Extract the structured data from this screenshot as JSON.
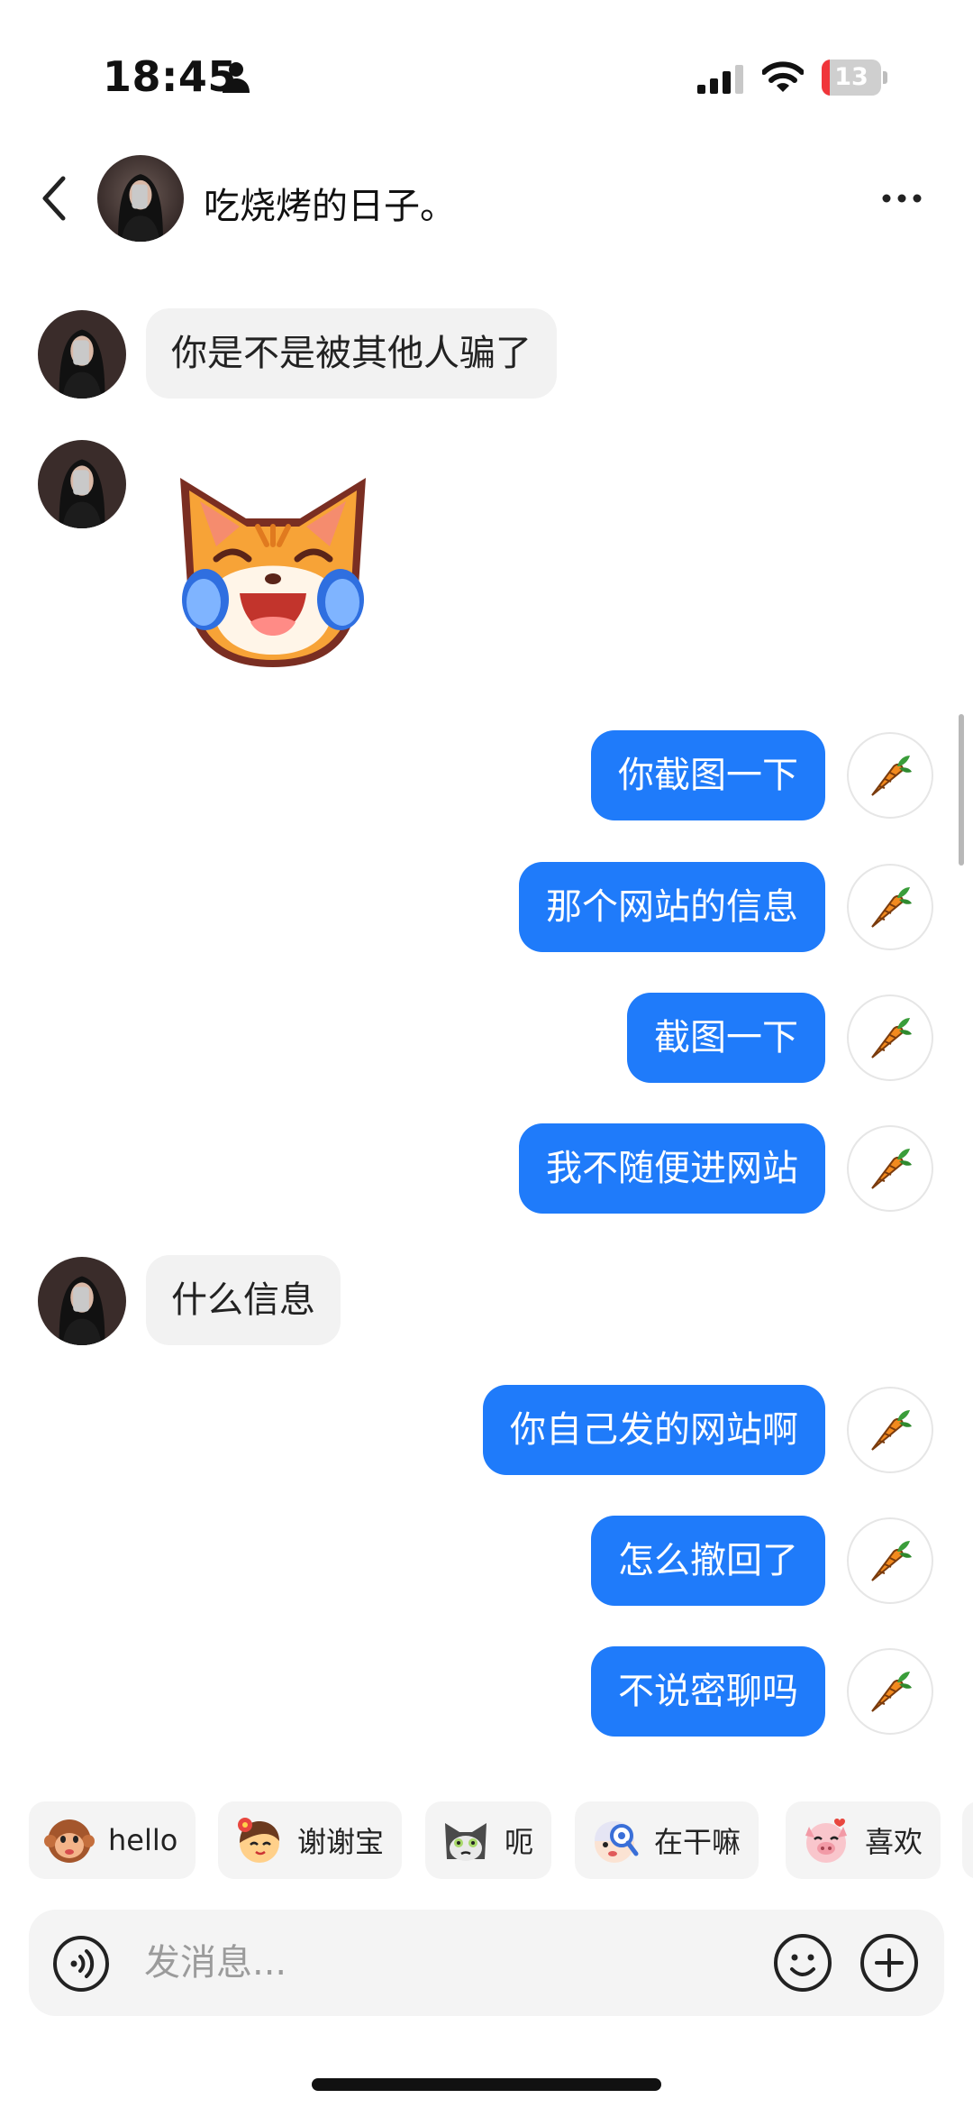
{
  "status_bar": {
    "time": "18:45",
    "battery": {
      "label": "13",
      "level_percent": 13,
      "color": "#f0353a"
    },
    "icons": [
      "person-icon",
      "signal-icon",
      "wifi-icon",
      "battery-icon"
    ]
  },
  "header": {
    "back_icon": "chevron-left-icon",
    "title": "吃烧烤的日子。",
    "more_icon": "more-dots-icon"
  },
  "colors": {
    "outgoing_bubble": "#1f7bfa",
    "incoming_bubble": "#f2f2f2"
  },
  "messages": [
    {
      "side": "incoming",
      "type": "text",
      "text": "你是不是被其他人骗了"
    },
    {
      "side": "incoming",
      "type": "sticker",
      "sticker": "crying-laughing-cat-sticker"
    },
    {
      "side": "outgoing",
      "type": "text",
      "text": "你截图一下"
    },
    {
      "side": "outgoing",
      "type": "text",
      "text": "那个网站的信息"
    },
    {
      "side": "outgoing",
      "type": "text",
      "text": "截图一下"
    },
    {
      "side": "outgoing",
      "type": "text",
      "text": "我不随便进网站"
    },
    {
      "side": "incoming",
      "type": "text",
      "text": "什么信息"
    },
    {
      "side": "outgoing",
      "type": "text",
      "text": "你自己发的网站啊"
    },
    {
      "side": "outgoing",
      "type": "text",
      "text": "怎么撤回了"
    },
    {
      "side": "outgoing",
      "type": "text",
      "text": "不说密聊吗"
    }
  ],
  "quick_replies": [
    {
      "label": "hello",
      "icon": "monkey-emoji-icon"
    },
    {
      "label": "谢谢宝",
      "icon": "flower-face-emoji-icon"
    },
    {
      "label": "呃",
      "icon": "cat-emoji-icon"
    },
    {
      "label": "在干嘛",
      "icon": "magnifier-face-emoji-icon"
    },
    {
      "label": "喜欢",
      "icon": "pig-emoji-icon"
    }
  ],
  "input": {
    "placeholder": "发消息...",
    "value": "",
    "left_icon": "voice-icon",
    "right_icons": [
      "emoji-icon",
      "plus-icon"
    ]
  }
}
